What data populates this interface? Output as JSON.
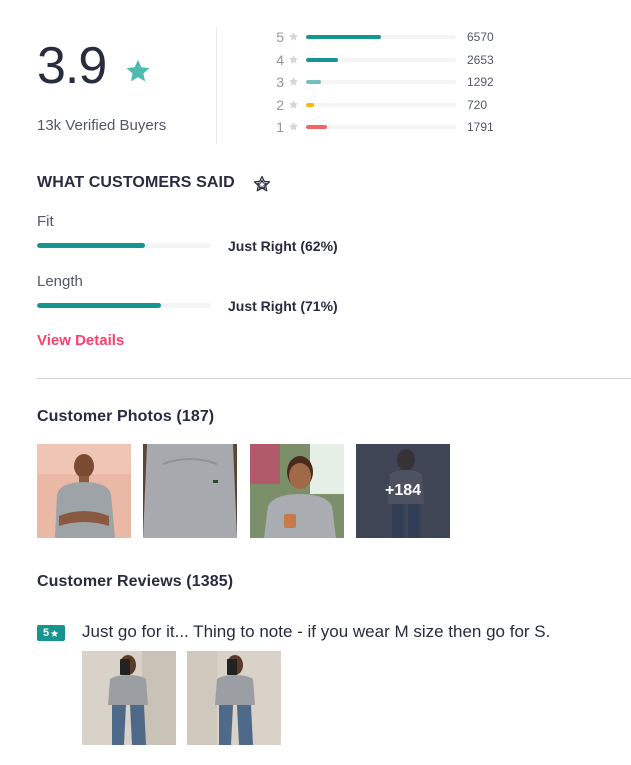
{
  "rating": {
    "average": "3.9",
    "verified_buyers": "13k Verified Buyers",
    "star_color": "#4dbbb0",
    "breakdown": [
      {
        "stars": "5",
        "count": "6570",
        "fraction": 0.5,
        "color": "#14958f"
      },
      {
        "stars": "4",
        "count": "2653",
        "fraction": 0.21,
        "color": "#14958f"
      },
      {
        "stars": "3",
        "count": "1292",
        "fraction": 0.1,
        "color": "#72bfbc"
      },
      {
        "stars": "2",
        "count": "720",
        "fraction": 0.05,
        "color": "#fcb301"
      },
      {
        "stars": "1",
        "count": "1791",
        "fraction": 0.14,
        "color": "#f16565"
      }
    ]
  },
  "customers_said": {
    "title": "WHAT CUSTOMERS SAID",
    "title_icon": "star-outline-icon",
    "attributes": [
      {
        "label": "Fit",
        "value": "Just Right (62%)",
        "fraction": 0.62
      },
      {
        "label": "Length",
        "value": "Just Right (71%)",
        "fraction": 0.71
      }
    ],
    "view_details": "View Details"
  },
  "photos": {
    "title": "Customer Photos (187)",
    "more_label": "+184"
  },
  "reviews": {
    "title": "Customer Reviews (1385)",
    "items": [
      {
        "rating": "5",
        "rating_icon": "star-icon",
        "text": "Just go for it... Thing to note - if you wear M size then go for S."
      }
    ]
  }
}
